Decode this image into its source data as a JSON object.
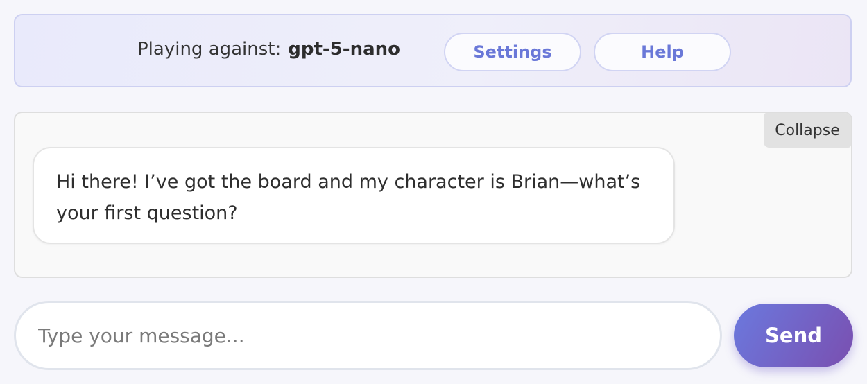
{
  "header": {
    "playing_against_label": "Playing against:",
    "model_name": "gpt-5-nano",
    "settings_label": "Settings",
    "help_label": "Help"
  },
  "chat": {
    "collapse_label": "Collapse",
    "messages": [
      {
        "text": "Hi there! I’ve got the board and my character is Brian—what’s your first question?"
      }
    ]
  },
  "composer": {
    "placeholder": "Type your message...",
    "value": "",
    "send_label": "Send"
  },
  "colors": {
    "accent": "#6a78d8",
    "send_gradient_start": "#6b79de",
    "send_gradient_end": "#7a4fb0"
  }
}
